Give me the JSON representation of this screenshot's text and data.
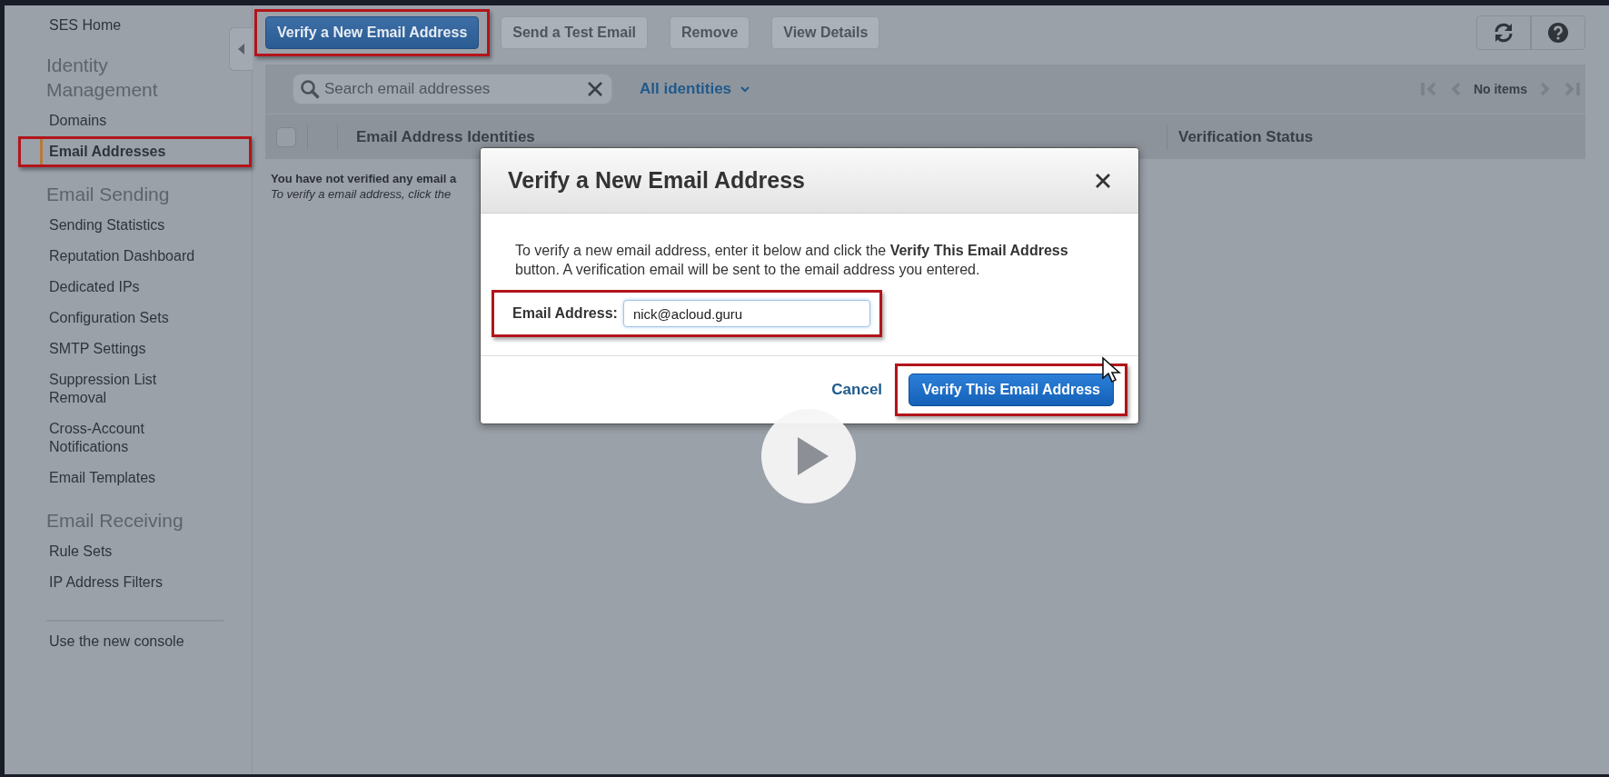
{
  "sidebar": {
    "home": "SES Home",
    "sections": [
      {
        "heading": "Identity Management",
        "items": [
          {
            "label": "Domains",
            "selected": false,
            "highlighted": false
          },
          {
            "label": "Email Addresses",
            "selected": true,
            "highlighted": true
          }
        ]
      },
      {
        "heading": "Email Sending",
        "items": [
          {
            "label": "Sending Statistics",
            "selected": false,
            "highlighted": false
          },
          {
            "label": "Reputation Dashboard",
            "selected": false,
            "highlighted": false
          },
          {
            "label": "Dedicated IPs",
            "selected": false,
            "highlighted": false
          },
          {
            "label": "Configuration Sets",
            "selected": false,
            "highlighted": false
          },
          {
            "label": "SMTP Settings",
            "selected": false,
            "highlighted": false
          },
          {
            "label": "Suppression List Removal",
            "selected": false,
            "highlighted": false
          },
          {
            "label": "Cross-Account Notifications",
            "selected": false,
            "highlighted": false
          },
          {
            "label": "Email Templates",
            "selected": false,
            "highlighted": false
          }
        ]
      },
      {
        "heading": "Email Receiving",
        "items": [
          {
            "label": "Rule Sets",
            "selected": false,
            "highlighted": false
          },
          {
            "label": "IP Address Filters",
            "selected": false,
            "highlighted": false
          }
        ]
      }
    ],
    "footer_link": "Use the new console"
  },
  "toolbar": {
    "buttons": [
      {
        "label": "Verify a New Email Address",
        "disabled": false,
        "highlighted": true
      },
      {
        "label": "Send a Test Email",
        "disabled": true,
        "highlighted": false
      },
      {
        "label": "Remove",
        "disabled": true,
        "highlighted": false
      },
      {
        "label": "View Details",
        "disabled": true,
        "highlighted": false
      }
    ]
  },
  "filter": {
    "search": {
      "placeholder": "Search email addresses"
    },
    "dropdown": "All identities",
    "pagination": "No items"
  },
  "table": {
    "select_all": {
      "checked": false
    },
    "columns": [
      "Email Address Identities",
      "Verification Status"
    ],
    "empty_message": "You have not verified any email a",
    "empty_hint": "To verify a email address, click the"
  },
  "dialog": {
    "title": "Verify a New Email Address",
    "description": "To verify a new email address, enter it below and click the **Verify This Email Address** button. A verification email will be sent to the email address you entered.",
    "field": {
      "label": "Email Address:",
      "value": "nick@acloud.guru",
      "highlighted": true
    },
    "cancel": "Cancel",
    "confirm": {
      "label": "Verify This Email Address",
      "highlighted": true
    }
  }
}
